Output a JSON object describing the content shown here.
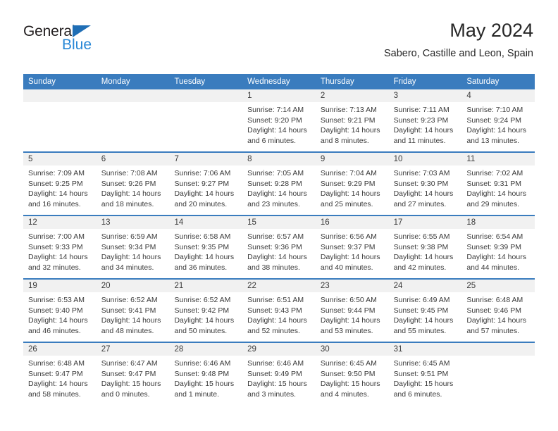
{
  "brand": {
    "name_dark": "General",
    "name_light": "Blue",
    "triangle_color": "#1f6eb5",
    "light_color": "#2787d6"
  },
  "header": {
    "title": "May 2024",
    "subtitle": "Sabero, Castille and Leon, Spain"
  },
  "theme": {
    "header_bg": "#3a7cbe",
    "daynum_bg": "#f1f1f1",
    "text": "#3a3a3a"
  },
  "weekdays": [
    "Sunday",
    "Monday",
    "Tuesday",
    "Wednesday",
    "Thursday",
    "Friday",
    "Saturday"
  ],
  "weeks": [
    [
      {
        "day": "",
        "sunrise": "",
        "sunset": "",
        "daylight": ""
      },
      {
        "day": "",
        "sunrise": "",
        "sunset": "",
        "daylight": ""
      },
      {
        "day": "",
        "sunrise": "",
        "sunset": "",
        "daylight": ""
      },
      {
        "day": "1",
        "sunrise": "Sunrise: 7:14 AM",
        "sunset": "Sunset: 9:20 PM",
        "daylight": "Daylight: 14 hours and 6 minutes."
      },
      {
        "day": "2",
        "sunrise": "Sunrise: 7:13 AM",
        "sunset": "Sunset: 9:21 PM",
        "daylight": "Daylight: 14 hours and 8 minutes."
      },
      {
        "day": "3",
        "sunrise": "Sunrise: 7:11 AM",
        "sunset": "Sunset: 9:23 PM",
        "daylight": "Daylight: 14 hours and 11 minutes."
      },
      {
        "day": "4",
        "sunrise": "Sunrise: 7:10 AM",
        "sunset": "Sunset: 9:24 PM",
        "daylight": "Daylight: 14 hours and 13 minutes."
      }
    ],
    [
      {
        "day": "5",
        "sunrise": "Sunrise: 7:09 AM",
        "sunset": "Sunset: 9:25 PM",
        "daylight": "Daylight: 14 hours and 16 minutes."
      },
      {
        "day": "6",
        "sunrise": "Sunrise: 7:08 AM",
        "sunset": "Sunset: 9:26 PM",
        "daylight": "Daylight: 14 hours and 18 minutes."
      },
      {
        "day": "7",
        "sunrise": "Sunrise: 7:06 AM",
        "sunset": "Sunset: 9:27 PM",
        "daylight": "Daylight: 14 hours and 20 minutes."
      },
      {
        "day": "8",
        "sunrise": "Sunrise: 7:05 AM",
        "sunset": "Sunset: 9:28 PM",
        "daylight": "Daylight: 14 hours and 23 minutes."
      },
      {
        "day": "9",
        "sunrise": "Sunrise: 7:04 AM",
        "sunset": "Sunset: 9:29 PM",
        "daylight": "Daylight: 14 hours and 25 minutes."
      },
      {
        "day": "10",
        "sunrise": "Sunrise: 7:03 AM",
        "sunset": "Sunset: 9:30 PM",
        "daylight": "Daylight: 14 hours and 27 minutes."
      },
      {
        "day": "11",
        "sunrise": "Sunrise: 7:02 AM",
        "sunset": "Sunset: 9:31 PM",
        "daylight": "Daylight: 14 hours and 29 minutes."
      }
    ],
    [
      {
        "day": "12",
        "sunrise": "Sunrise: 7:00 AM",
        "sunset": "Sunset: 9:33 PM",
        "daylight": "Daylight: 14 hours and 32 minutes."
      },
      {
        "day": "13",
        "sunrise": "Sunrise: 6:59 AM",
        "sunset": "Sunset: 9:34 PM",
        "daylight": "Daylight: 14 hours and 34 minutes."
      },
      {
        "day": "14",
        "sunrise": "Sunrise: 6:58 AM",
        "sunset": "Sunset: 9:35 PM",
        "daylight": "Daylight: 14 hours and 36 minutes."
      },
      {
        "day": "15",
        "sunrise": "Sunrise: 6:57 AM",
        "sunset": "Sunset: 9:36 PM",
        "daylight": "Daylight: 14 hours and 38 minutes."
      },
      {
        "day": "16",
        "sunrise": "Sunrise: 6:56 AM",
        "sunset": "Sunset: 9:37 PM",
        "daylight": "Daylight: 14 hours and 40 minutes."
      },
      {
        "day": "17",
        "sunrise": "Sunrise: 6:55 AM",
        "sunset": "Sunset: 9:38 PM",
        "daylight": "Daylight: 14 hours and 42 minutes."
      },
      {
        "day": "18",
        "sunrise": "Sunrise: 6:54 AM",
        "sunset": "Sunset: 9:39 PM",
        "daylight": "Daylight: 14 hours and 44 minutes."
      }
    ],
    [
      {
        "day": "19",
        "sunrise": "Sunrise: 6:53 AM",
        "sunset": "Sunset: 9:40 PM",
        "daylight": "Daylight: 14 hours and 46 minutes."
      },
      {
        "day": "20",
        "sunrise": "Sunrise: 6:52 AM",
        "sunset": "Sunset: 9:41 PM",
        "daylight": "Daylight: 14 hours and 48 minutes."
      },
      {
        "day": "21",
        "sunrise": "Sunrise: 6:52 AM",
        "sunset": "Sunset: 9:42 PM",
        "daylight": "Daylight: 14 hours and 50 minutes."
      },
      {
        "day": "22",
        "sunrise": "Sunrise: 6:51 AM",
        "sunset": "Sunset: 9:43 PM",
        "daylight": "Daylight: 14 hours and 52 minutes."
      },
      {
        "day": "23",
        "sunrise": "Sunrise: 6:50 AM",
        "sunset": "Sunset: 9:44 PM",
        "daylight": "Daylight: 14 hours and 53 minutes."
      },
      {
        "day": "24",
        "sunrise": "Sunrise: 6:49 AM",
        "sunset": "Sunset: 9:45 PM",
        "daylight": "Daylight: 14 hours and 55 minutes."
      },
      {
        "day": "25",
        "sunrise": "Sunrise: 6:48 AM",
        "sunset": "Sunset: 9:46 PM",
        "daylight": "Daylight: 14 hours and 57 minutes."
      }
    ],
    [
      {
        "day": "26",
        "sunrise": "Sunrise: 6:48 AM",
        "sunset": "Sunset: 9:47 PM",
        "daylight": "Daylight: 14 hours and 58 minutes."
      },
      {
        "day": "27",
        "sunrise": "Sunrise: 6:47 AM",
        "sunset": "Sunset: 9:47 PM",
        "daylight": "Daylight: 15 hours and 0 minutes."
      },
      {
        "day": "28",
        "sunrise": "Sunrise: 6:46 AM",
        "sunset": "Sunset: 9:48 PM",
        "daylight": "Daylight: 15 hours and 1 minute."
      },
      {
        "day": "29",
        "sunrise": "Sunrise: 6:46 AM",
        "sunset": "Sunset: 9:49 PM",
        "daylight": "Daylight: 15 hours and 3 minutes."
      },
      {
        "day": "30",
        "sunrise": "Sunrise: 6:45 AM",
        "sunset": "Sunset: 9:50 PM",
        "daylight": "Daylight: 15 hours and 4 minutes."
      },
      {
        "day": "31",
        "sunrise": "Sunrise: 6:45 AM",
        "sunset": "Sunset: 9:51 PM",
        "daylight": "Daylight: 15 hours and 6 minutes."
      },
      {
        "day": "",
        "sunrise": "",
        "sunset": "",
        "daylight": ""
      }
    ]
  ]
}
